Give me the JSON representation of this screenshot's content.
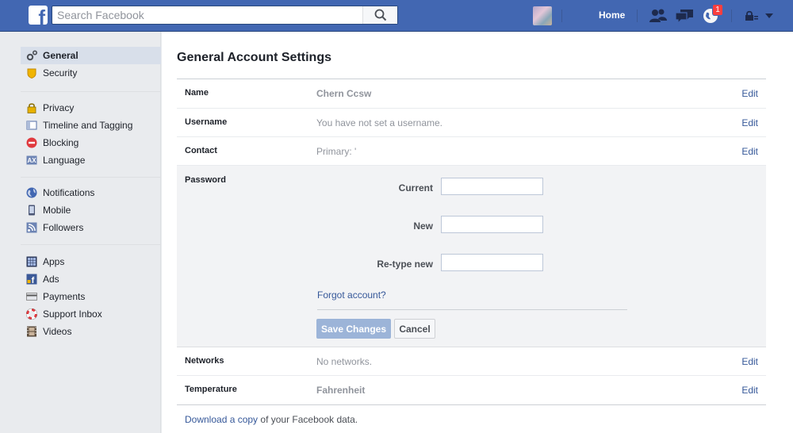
{
  "topbar": {
    "search_placeholder": "Search Facebook",
    "home_label": "Home",
    "notifications_count": "1",
    "brand_color": "#4267b2",
    "icons": [
      "facebook-logo-icon",
      "search-icon",
      "friend-requests-icon",
      "messages-icon",
      "notifications-globe-icon",
      "privacy-lock-icon",
      "chevron-down-icon"
    ]
  },
  "sidebar": {
    "groups": [
      {
        "items": [
          {
            "label": "General",
            "icon": "gear-icon",
            "active": true
          },
          {
            "label": "Security",
            "icon": "shield-icon"
          }
        ]
      },
      {
        "items": [
          {
            "label": "Privacy",
            "icon": "lock-icon"
          },
          {
            "label": "Timeline and Tagging",
            "icon": "timeline-icon"
          },
          {
            "label": "Blocking",
            "icon": "blocking-icon"
          },
          {
            "label": "Language",
            "icon": "language-icon"
          }
        ]
      },
      {
        "items": [
          {
            "label": "Notifications",
            "icon": "globe-icon"
          },
          {
            "label": "Mobile",
            "icon": "mobile-icon"
          },
          {
            "label": "Followers",
            "icon": "rss-icon"
          }
        ]
      },
      {
        "items": [
          {
            "label": "Apps",
            "icon": "apps-icon"
          },
          {
            "label": "Ads",
            "icon": "ads-icon"
          },
          {
            "label": "Payments",
            "icon": "credit-card-icon"
          },
          {
            "label": "Support Inbox",
            "icon": "lifebuoy-icon"
          },
          {
            "label": "Videos",
            "icon": "film-icon"
          }
        ]
      }
    ]
  },
  "main": {
    "title": "General Account Settings",
    "rows": {
      "name": {
        "label": "Name",
        "value": "Chern Ccsw",
        "edit": "Edit"
      },
      "username": {
        "label": "Username",
        "value": "You have not set a username.",
        "edit": "Edit"
      },
      "contact": {
        "label": "Contact",
        "value": "Primary: '",
        "edit": "Edit"
      },
      "networks": {
        "label": "Networks",
        "value": "No networks.",
        "edit": "Edit"
      },
      "temperature": {
        "label": "Temperature",
        "value": "Fahrenheit",
        "edit": "Edit"
      }
    },
    "password": {
      "label": "Password",
      "current_label": "Current",
      "new_label": "New",
      "retype_label": "Re-type new",
      "current_value": "",
      "new_value": "",
      "retype_value": "",
      "forgot_link": "Forgot account?",
      "save_button": "Save Changes",
      "cancel_button": "Cancel"
    },
    "download": {
      "link": "Download a copy",
      "rest": " of your Facebook data."
    }
  }
}
